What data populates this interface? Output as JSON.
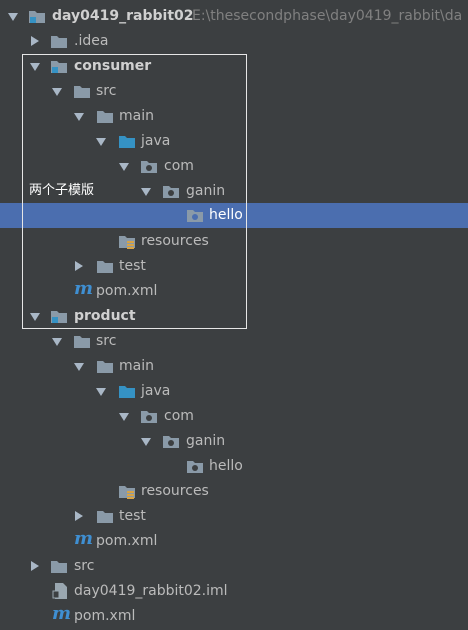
{
  "tree": {
    "root": {
      "name": "day0419_rabbit02",
      "path": "E:\\thesecondphase\\day0419_rabbit\\da"
    },
    "idea": ".idea",
    "consumer": {
      "name": "consumer",
      "src": "src",
      "main": "main",
      "java": "java",
      "com": "com",
      "ganin": "ganin",
      "hello": "hello",
      "resources": "resources",
      "test": "test",
      "pom": "pom.xml"
    },
    "product": {
      "name": "product",
      "src": "src",
      "main": "main",
      "java": "java",
      "com": "com",
      "ganin": "ganin",
      "hello": "hello",
      "resources": "resources",
      "test": "test",
      "pom": "pom.xml"
    },
    "src": "src",
    "iml": "day0419_rabbit02.iml",
    "pom": "pom.xml"
  },
  "annotation": {
    "text": "两个子模版"
  },
  "colors": {
    "background": "#3c3f41",
    "selection": "#4b6eaf",
    "folder": "#8a9aa8",
    "source_folder": "#3592c4",
    "maven": "#3f8fd2"
  }
}
